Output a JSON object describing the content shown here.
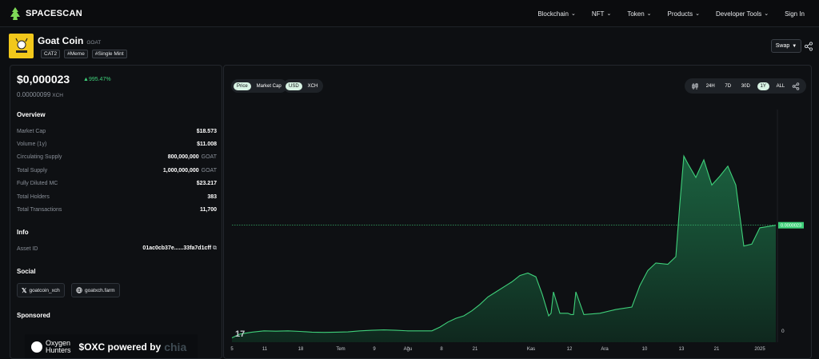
{
  "nav": {
    "brand": "SPACESCAN",
    "links": [
      "Blockchain",
      "NFT",
      "Token",
      "Products",
      "Developer Tools"
    ],
    "sign_in": "Sign In"
  },
  "token": {
    "name": "Goat Coin",
    "symbol": "GOAT",
    "tags": [
      "CAT2",
      "#Meme",
      "#Single Mint"
    ],
    "swap_label": "Swap"
  },
  "price": {
    "usd": "$0,000023",
    "change": "995.47%",
    "xch": "0.00000099",
    "xch_unit": "XCH"
  },
  "overview": {
    "title": "Overview",
    "rows": [
      {
        "label": "Market Cap",
        "value": "$18.573",
        "unit": ""
      },
      {
        "label": "Volume (1y)",
        "value": "$11.008",
        "unit": ""
      },
      {
        "label": "Circulating Supply",
        "value": "800,000,000",
        "unit": "GOAT"
      },
      {
        "label": "Total Supply",
        "value": "1,000,000,000",
        "unit": "GOAT"
      },
      {
        "label": "Fully Diluted MC",
        "value": "$23.217",
        "unit": ""
      },
      {
        "label": "Total Holders",
        "value": "383",
        "unit": ""
      },
      {
        "label": "Total Transactions",
        "value": "11,700",
        "unit": ""
      }
    ]
  },
  "info": {
    "title": "Info",
    "asset_label": "Asset ID",
    "asset_value": "01ac0cb37e......33fa7d1cff"
  },
  "social": {
    "title": "Social",
    "twitter": "goatcoin_xch",
    "website": "goatxch.farm"
  },
  "sponsored": {
    "title": "Sponsored",
    "brand_line1": "Oxygen",
    "brand_line2": "Hunters",
    "text": "$OXC powered by",
    "chia": "chia"
  },
  "chart_controls": {
    "metric": [
      "Price",
      "Market Cap"
    ],
    "metric_active": "Price",
    "currency": [
      "USD",
      "XCH"
    ],
    "currency_active": "USD",
    "ranges": [
      "24H",
      "7D",
      "30D",
      "1Y",
      "ALL"
    ],
    "range_active": "1Y"
  },
  "chart_data": {
    "type": "area",
    "series_color": "#3fd07a",
    "current_value_label": "0.0000023",
    "y_tick_zero": "0",
    "x_ticks": [
      "5",
      "11",
      "18",
      "Tem",
      "9",
      "Ağu",
      "8",
      "21",
      "Kas",
      "12",
      "Ara",
      "10",
      "13",
      "21",
      "2025"
    ],
    "x": [
      0,
      10,
      25,
      40,
      55,
      70,
      85,
      100,
      115,
      130,
      145,
      160,
      175,
      190,
      205,
      220,
      235,
      250,
      260,
      270,
      280,
      290,
      300,
      310,
      320,
      330,
      340,
      350,
      360,
      370,
      380,
      388,
      396,
      399,
      402,
      410,
      420,
      424,
      427,
      430,
      440,
      460,
      480,
      500,
      510,
      520,
      530,
      545,
      555,
      560,
      565,
      570,
      580,
      590,
      600,
      610,
      620,
      630,
      640,
      650,
      660,
      670,
      680
    ],
    "values": [
      3.5e-07,
      6.5e-07,
      8e-07,
      9e-07,
      8.8e-07,
      9e-07,
      8.6e-07,
      8e-07,
      7.8e-07,
      8e-07,
      8.2e-07,
      9e-07,
      9.5e-07,
      9.8e-07,
      9.5e-07,
      9e-07,
      9e-07,
      9e-07,
      1.2e-06,
      1.6e-06,
      1.9e-06,
      2.1e-06,
      2.5e-06,
      3e-06,
      3.6e-06,
      4e-06,
      4.4e-06,
      4.8e-06,
      5.3e-06,
      5.5e-06,
      5.2e-06,
      3.8e-06,
      2.1e-06,
      2.3e-06,
      4e-06,
      2.3e-06,
      2.3e-06,
      2.2e-06,
      2.2e-06,
      4e-06,
      2.2e-06,
      2.3e-06,
      2.6e-06,
      2.8e-06,
      4.5e-06,
      5.7e-06,
      6.3e-06,
      6.2e-06,
      6.8e-06,
      1.1e-05,
      1.48e-05,
      1.42e-05,
      1.31e-05,
      1.45e-05,
      1.25e-05,
      1.32e-05,
      1.4e-05,
      1.25e-05,
      7.65e-06,
      7.8e-06,
      9.1e-06,
      9.2e-06,
      9.3e-06
    ]
  }
}
